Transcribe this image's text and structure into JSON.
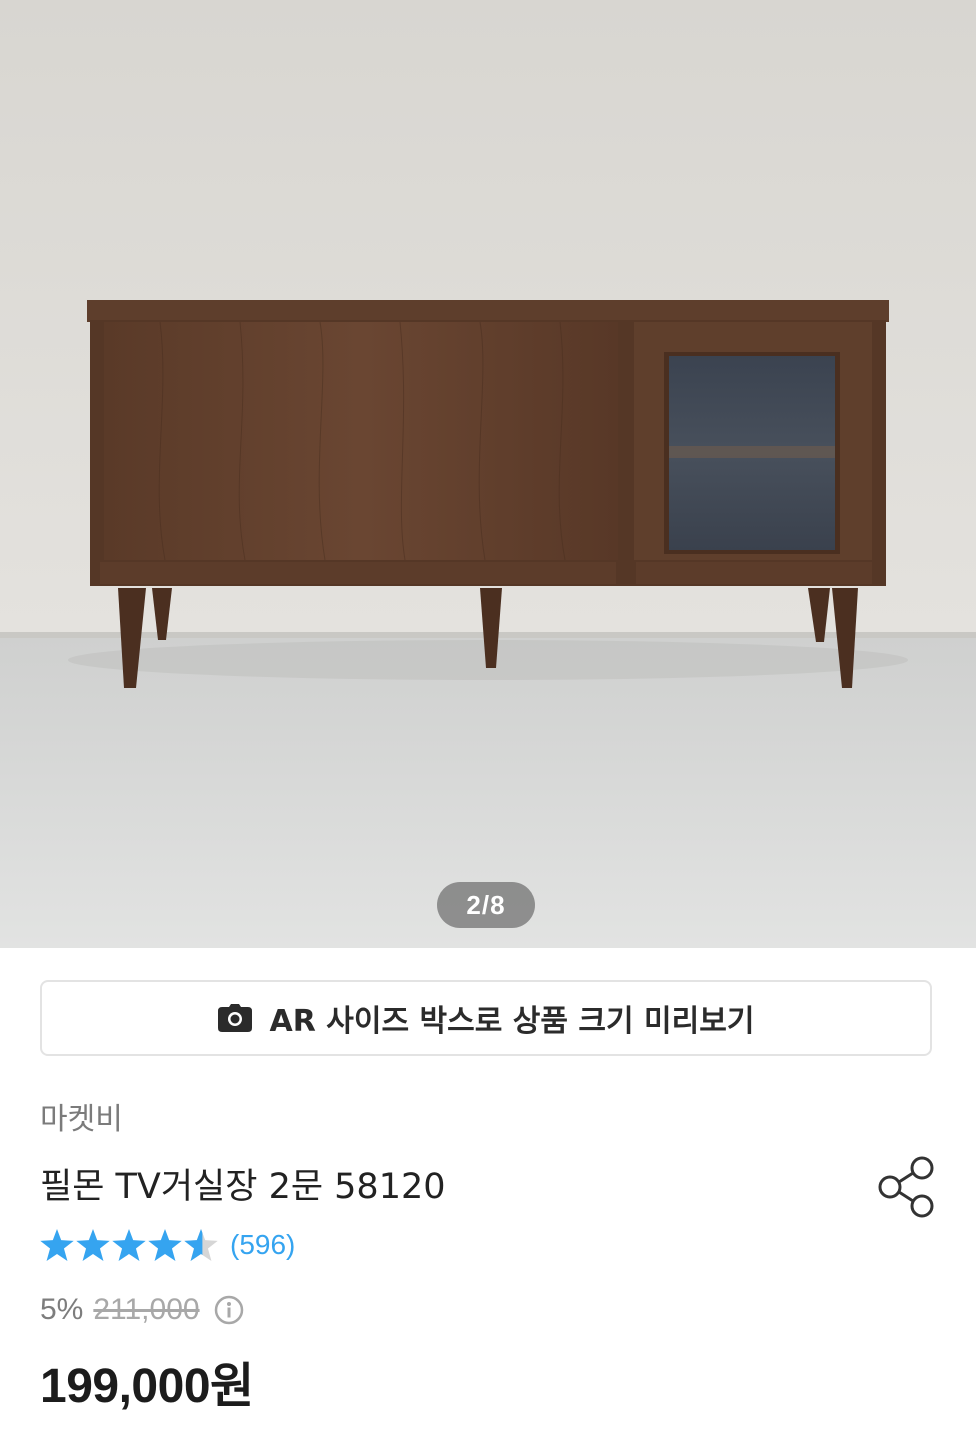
{
  "gallery": {
    "counter": "2/8",
    "image_alt": "wooden TV console cabinet"
  },
  "ar_button": {
    "label": "AR 사이즈 박스로 상품 크기 미리보기",
    "icon": "camera-icon"
  },
  "product": {
    "brand": "마켓비",
    "title": "필몬 TV거실장 2문 58120",
    "share_icon": "share-icon",
    "rating": {
      "stars": 4.5,
      "count": "(596)",
      "star_color": "#35a4f0"
    },
    "discount": "5%",
    "original_price": "211,000",
    "info_icon": "info-icon",
    "price": "199,000원"
  }
}
